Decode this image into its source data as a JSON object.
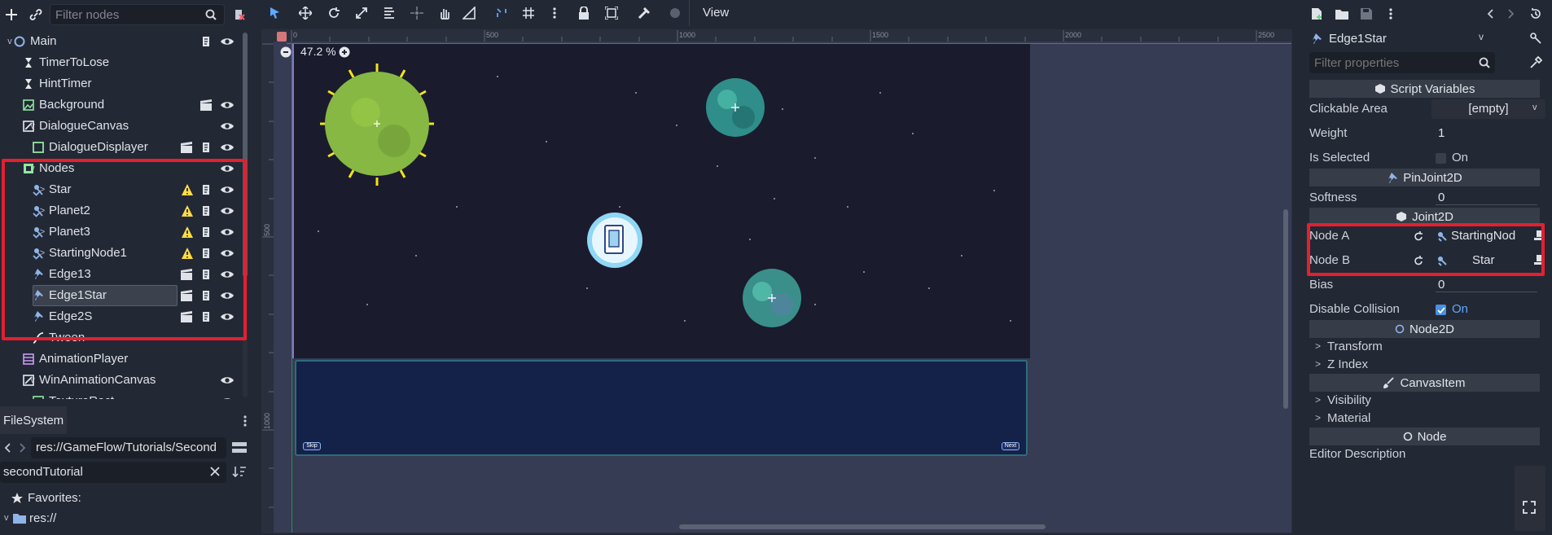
{
  "scene_dock": {
    "filter_placeholder": "Filter nodes",
    "tree": [
      {
        "label": "Main",
        "indent": 0,
        "arrow": "v",
        "icon": "node2d-circle-icon",
        "right": [
          "script-icon",
          "eye-icon"
        ]
      },
      {
        "label": "TimerToLose",
        "indent": 1,
        "arrow": "",
        "icon": "hourglass-icon",
        "right": []
      },
      {
        "label": "HintTimer",
        "indent": 1,
        "arrow": "",
        "icon": "hourglass-icon",
        "right": []
      },
      {
        "label": "Background",
        "indent": 1,
        "arrow": "",
        "icon": "texture-rect-icon",
        "right": [
          "clapper-icon",
          "eye-icon"
        ]
      },
      {
        "label": "DialogueCanvas",
        "indent": 1,
        "arrow": "v",
        "icon": "canvas-layer-icon",
        "right": [
          "eye-icon"
        ]
      },
      {
        "label": "DialogueDisplayer",
        "indent": 2,
        "arrow": "",
        "icon": "control-icon",
        "right": [
          "clapper-icon",
          "script-icon",
          "eye-icon"
        ]
      },
      {
        "label": "Nodes",
        "indent": 1,
        "arrow": "v",
        "icon": "node-group-icon",
        "right": [
          "eye-icon"
        ]
      },
      {
        "label": "Star",
        "indent": 2,
        "arrow": ">",
        "icon": "scene-instance-icon",
        "right": [
          "warning-icon",
          "script-icon",
          "eye-icon"
        ]
      },
      {
        "label": "Planet2",
        "indent": 2,
        "arrow": ">",
        "icon": "scene-instance-icon",
        "right": [
          "warning-icon",
          "script-icon",
          "eye-icon"
        ]
      },
      {
        "label": "Planet3",
        "indent": 2,
        "arrow": ">",
        "icon": "scene-instance-icon",
        "right": [
          "warning-icon",
          "script-icon",
          "eye-icon"
        ]
      },
      {
        "label": "StartingNode1",
        "indent": 2,
        "arrow": ">",
        "icon": "scene-instance-icon",
        "right": [
          "warning-icon",
          "script-icon",
          "eye-icon"
        ]
      },
      {
        "label": "Edge13",
        "indent": 2,
        "arrow": "",
        "icon": "pin-icon",
        "right": [
          "clapper-icon",
          "script-icon",
          "eye-icon"
        ]
      },
      {
        "label": "Edge1Star",
        "indent": 2,
        "arrow": "",
        "icon": "pin-icon",
        "right": [
          "clapper-icon",
          "script-icon",
          "eye-icon"
        ],
        "selected": true
      },
      {
        "label": "Edge2S",
        "indent": 2,
        "arrow": "",
        "icon": "pin-icon",
        "right": [
          "clapper-icon",
          "script-icon",
          "eye-icon"
        ]
      },
      {
        "label": "Tween",
        "indent": 2,
        "arrow": "",
        "icon": "tween-icon",
        "right": []
      },
      {
        "label": "AnimationPlayer",
        "indent": 1,
        "arrow": "",
        "icon": "animation-player-icon",
        "right": []
      },
      {
        "label": "WinAnimationCanvas",
        "indent": 1,
        "arrow": "v",
        "icon": "canvas-layer-icon",
        "right": [
          "eye-icon"
        ]
      },
      {
        "label": "TextureRect",
        "indent": 2,
        "arrow": "",
        "icon": "texture-rect-icon",
        "right": [
          "eye-icon"
        ]
      }
    ]
  },
  "filesystem": {
    "tab_label": "FileSystem",
    "path": "res://GameFlow/Tutorials/Second",
    "search_value": "secondTutorial",
    "favorites_label": "Favorites:",
    "res_label": "res://"
  },
  "viewport": {
    "menu_label": "View",
    "zoom_label": "47.2 %",
    "ruler_h_ticks": [
      "0",
      "500",
      "1000",
      "1500",
      "2000",
      "2500"
    ],
    "ruler_v_ticks": [
      "500",
      "1000"
    ],
    "skip_label": "Skip",
    "next_label": "Next"
  },
  "inspector": {
    "node_name": "Edge1Star",
    "filter_placeholder": "Filter properties",
    "sections": {
      "script_variables": "Script Variables",
      "pinjoint": "PinJoint2D",
      "joint": "Joint2D",
      "node2d": "Node2D",
      "canvas_item": "CanvasItem",
      "node": "Node"
    },
    "props": {
      "clickable_area_label": "Clickable Area",
      "clickable_area_value": "[empty]",
      "weight_label": "Weight",
      "weight_value": "1",
      "is_selected_label": "Is Selected",
      "is_selected_value": "On",
      "softness_label": "Softness",
      "softness_value": "0",
      "node_a_label": "Node A",
      "node_a_value": "StartingNod",
      "node_b_label": "Node B",
      "node_b_value": "Star",
      "bias_label": "Bias",
      "bias_value": "0",
      "disable_collision_label": "Disable Collision",
      "disable_collision_value": "On",
      "editor_description_label": "Editor Description"
    },
    "collapsibles": {
      "transform": "Transform",
      "z_index": "Z Index",
      "visibility": "Visibility",
      "material": "Material"
    }
  },
  "colors": {
    "highlight_box": "#e3202f",
    "accent_blue": "#5fa8ff",
    "warning_yellow": "#ffdd44"
  }
}
